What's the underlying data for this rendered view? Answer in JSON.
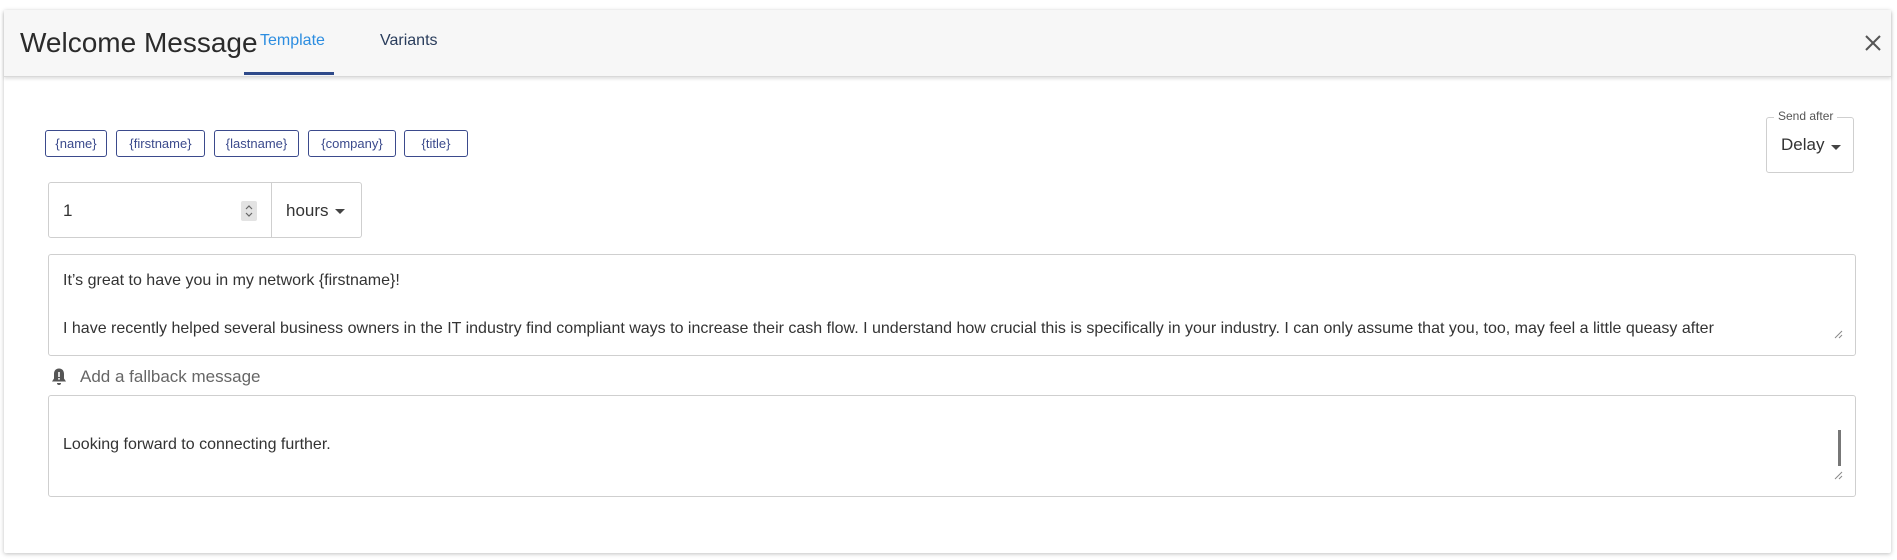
{
  "dialog": {
    "title": "Welcome Message",
    "tabs": [
      {
        "label": "Template",
        "active": true
      },
      {
        "label": "Variants",
        "active": false
      }
    ],
    "close_icon": "close-icon"
  },
  "variables": [
    "{name}",
    "{firstname}",
    "{lastname}",
    "{company}",
    "{title}"
  ],
  "send_after": {
    "legend": "Send after",
    "value": "Delay"
  },
  "delay": {
    "value": "1",
    "unit": "hours"
  },
  "message": {
    "line1": "It’s great to have you in my network {firstname}!",
    "line2": "I have recently helped several business owners in the IT industry find compliant ways to increase their cash flow. I understand how crucial this is specifically in your industry. I can only assume that you, too, may feel a little queasy after"
  },
  "fallback": {
    "icon": "bell-icon",
    "label": "Add a fallback message"
  },
  "fallback_message": {
    "line1": "Looking forward to connecting further."
  },
  "colors": {
    "accent": "#2c8de0",
    "tab_underline": "#2f4a8a",
    "chip_border": "#3b4a8c"
  }
}
